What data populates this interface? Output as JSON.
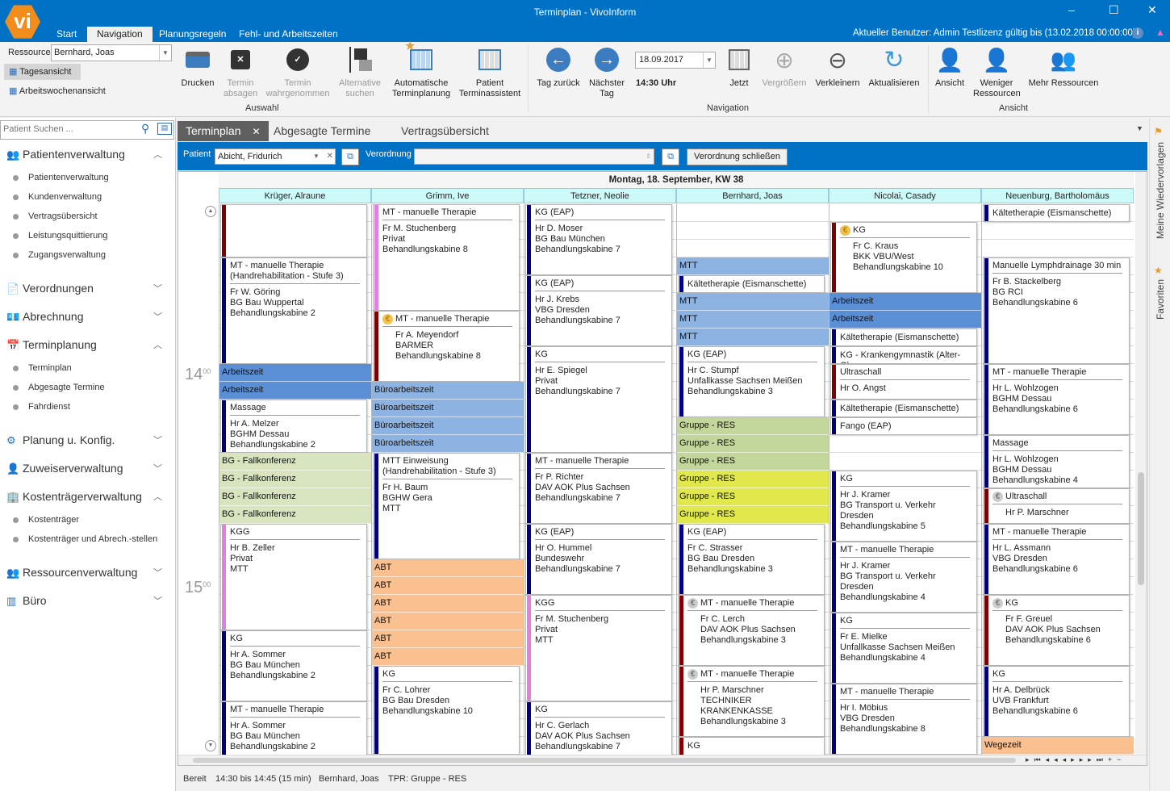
{
  "window": {
    "title": "Terminplan - VivoInform",
    "logo": "vi",
    "user_info": "Aktueller Benutzer: Admin Testlizenz gültig bis (13.02.2018 00:00:00)",
    "minimize": "–",
    "maximize": "☐",
    "close": "✕"
  },
  "ribbon_tabs": [
    "Start",
    "Navigation",
    "Planungsregeln",
    "Fehl- und Arbeitszeiten"
  ],
  "ribbon": {
    "ressource_label": "Ressource",
    "ressource_value": "Bernhard, Joas",
    "views": [
      "Tagesansicht",
      "Arbeitswochenansicht"
    ],
    "auswahl": {
      "label": "Auswahl",
      "buttons": [
        "Drucken",
        "Termin absagen",
        "Termin wahrgenommen",
        "Alternative suchen",
        "Automatische Terminplanung",
        "Patient Terminassistent"
      ]
    },
    "navigation": {
      "label": "Navigation",
      "back": "Tag zurück",
      "next": "Nächster Tag",
      "date": "18.09.2017",
      "time": "14:30 Uhr",
      "buttons": [
        "Jetzt",
        "Vergrößern",
        "Verkleinern",
        "Aktualisieren"
      ]
    },
    "ansicht": {
      "label": "Ansicht",
      "buttons": [
        "Ansicht",
        "Weniger Ressourcen",
        "Mehr Ressourcen"
      ]
    }
  },
  "sidebar": {
    "search_placeholder": "Patient Suchen ...",
    "sections": [
      {
        "label": "Patientenverwaltung",
        "expanded": true,
        "items": [
          "Patientenverwaltung",
          "Kundenverwaltung",
          "Vertragsübersicht",
          "Leistungsquittierung",
          "Zugangsverwaltung"
        ]
      },
      {
        "label": "Verordnungen",
        "expanded": false,
        "items": []
      },
      {
        "label": "Abrechnung",
        "expanded": false,
        "items": []
      },
      {
        "label": "Terminplanung",
        "expanded": true,
        "items": [
          "Terminplan",
          "Abgesagte Termine",
          "Fahrdienst"
        ]
      },
      {
        "label": "Planung u. Konfig.",
        "expanded": false,
        "items": []
      },
      {
        "label": "Zuweiserverwaltung",
        "expanded": false,
        "items": []
      },
      {
        "label": "Kostenträgerverwaltung",
        "expanded": true,
        "items": [
          "Kostenträger",
          "Kostenträger und Abrech.-stellen"
        ]
      },
      {
        "label": "Ressourcenverwaltung",
        "expanded": false,
        "items": []
      },
      {
        "label": "Büro",
        "expanded": false,
        "items": []
      }
    ]
  },
  "rightbar": {
    "wiedervorlagen": "Meine Wiedervorlagen",
    "favoriten": "Favoriten"
  },
  "doc_tabs": [
    "Terminplan",
    "Abgesagte Termine",
    "Vertragsübersicht"
  ],
  "patient_bar": {
    "patient_label": "Patient",
    "patient_value": "Abicht, Fridurich",
    "verordnung_label": "Verordnung",
    "verordnung_value": "",
    "close_button": "Verordnung schließen"
  },
  "calendar": {
    "date_header": "Montag, 18. September, KW 38",
    "visible_start": "13:15",
    "visible_end": "15:50",
    "time_labels": [
      {
        "h": "14",
        "m": "00"
      },
      {
        "h": "15",
        "m": "00"
      }
    ],
    "colors": {
      "navy": "#000080",
      "red": "#7f0000",
      "pink": "#e080e0",
      "arbeitszeit": "#5a8fd6",
      "buero": "#8db3e2",
      "fallkonferenz": "#d7e4bd",
      "gruppe": "#c3d69b",
      "gruppe_hl": "#e0e84c",
      "abt": "#fac08f"
    },
    "columns": [
      {
        "name": "Krüger, Alraune",
        "entries": [
          {
            "s": "13:15",
            "e": "13:30",
            "bar": "red",
            "title": "",
            "lines": []
          },
          {
            "s": "13:30",
            "e": "14:00",
            "bar": "navy",
            "title": "MT - manuelle Therapie (Handrehabilitation - Stufe 3)",
            "lines": [
              "Fr W. Göring",
              "BG Bau Wuppertal",
              "Behandlungskabine 2"
            ]
          },
          {
            "s": "14:00",
            "e": "14:05",
            "block": "arbeitszeit",
            "title": "Arbeitszeit"
          },
          {
            "s": "14:05",
            "e": "14:10",
            "block": "arbeitszeit",
            "title": "Arbeitszeit"
          },
          {
            "s": "14:10",
            "e": "14:25",
            "bar": "navy",
            "title": "Massage",
            "lines": [
              "Hr A. Melzer",
              "BGHM Dessau",
              "Behandlungskabine 2"
            ]
          },
          {
            "s": "14:25",
            "e": "14:30",
            "block": "fallkonferenz",
            "title": "BG - Fallkonferenz"
          },
          {
            "s": "14:30",
            "e": "14:35",
            "block": "fallkonferenz",
            "title": "BG - Fallkonferenz"
          },
          {
            "s": "14:35",
            "e": "14:40",
            "block": "fallkonferenz",
            "title": "BG - Fallkonferenz"
          },
          {
            "s": "14:40",
            "e": "14:45",
            "block": "fallkonferenz",
            "title": "BG - Fallkonferenz"
          },
          {
            "s": "14:45",
            "e": "15:15",
            "bar": "pink",
            "title": "KGG",
            "lines": [
              "Hr B. Zeller",
              "Privat",
              "MTT"
            ]
          },
          {
            "s": "15:15",
            "e": "15:35",
            "bar": "navy",
            "title": "KG",
            "lines": [
              "Hr A. Sommer",
              "BG Bau München",
              "Behandlungskabine 2"
            ]
          },
          {
            "s": "15:35",
            "e": "15:55",
            "bar": "navy",
            "title": "MT - manuelle Therapie",
            "lines": [
              "Hr A. Sommer",
              "BG Bau München",
              "Behandlungskabine 2"
            ]
          }
        ]
      },
      {
        "name": "Grimm, Ive",
        "entries": [
          {
            "s": "13:15",
            "e": "13:45",
            "bar": "pink",
            "title": "MT - manuelle Therapie",
            "lines": [
              "Fr M. Stuchenberg",
              "Privat",
              "Behandlungskabine 8"
            ]
          },
          {
            "s": "13:45",
            "e": "14:05",
            "bar": "red",
            "icon": "euro",
            "title": "MT - manuelle Therapie",
            "lines": [
              "Fr A. Meyendorf",
              "BARMER",
              "Behandlungskabine 8"
            ]
          },
          {
            "s": "14:05",
            "e": "14:10",
            "block": "buero",
            "title": "Büroarbeitszeit"
          },
          {
            "s": "14:10",
            "e": "14:15",
            "block": "buero",
            "title": "Büroarbeitszeit"
          },
          {
            "s": "14:15",
            "e": "14:20",
            "block": "buero",
            "title": "Büroarbeitszeit"
          },
          {
            "s": "14:20",
            "e": "14:25",
            "block": "buero",
            "title": "Büroarbeitszeit"
          },
          {
            "s": "14:25",
            "e": "14:55",
            "bar": "navy",
            "title": "MTT Einweisung (Handrehabilitation - Stufe 3)",
            "lines": [
              "Fr H. Baum",
              "BGHW Gera",
              "MTT"
            ]
          },
          {
            "s": "14:55",
            "e": "15:00",
            "block": "abt",
            "title": "ABT"
          },
          {
            "s": "15:00",
            "e": "15:05",
            "block": "abt",
            "title": "ABT"
          },
          {
            "s": "15:05",
            "e": "15:10",
            "block": "abt",
            "title": "ABT"
          },
          {
            "s": "15:10",
            "e": "15:15",
            "block": "abt",
            "title": "ABT"
          },
          {
            "s": "15:15",
            "e": "15:20",
            "block": "abt",
            "title": "ABT"
          },
          {
            "s": "15:20",
            "e": "15:25",
            "block": "abt",
            "title": "ABT"
          },
          {
            "s": "15:25",
            "e": "15:50",
            "bar": "navy",
            "title": "KG",
            "lines": [
              "Fr C. Lohrer",
              "BG Bau Dresden",
              "Behandlungskabine 10"
            ]
          }
        ]
      },
      {
        "name": "Tetzner, Neolie",
        "entries": [
          {
            "s": "13:15",
            "e": "13:35",
            "bar": "navy",
            "title": "KG (EAP)",
            "lines": [
              "Hr D. Moser",
              "BG Bau München",
              "Behandlungskabine 7"
            ]
          },
          {
            "s": "13:35",
            "e": "13:55",
            "bar": "navy",
            "title": "KG (EAP)",
            "lines": [
              "Hr J. Krebs",
              "VBG Dresden",
              "Behandlungskabine 7"
            ]
          },
          {
            "s": "13:55",
            "e": "14:25",
            "bar": "navy",
            "title": "KG",
            "lines": [
              "Hr E. Spiegel",
              "Privat",
              "Behandlungskabine 7"
            ]
          },
          {
            "s": "14:25",
            "e": "14:45",
            "bar": "navy",
            "title": "MT - manuelle Therapie",
            "lines": [
              "Fr P. Richter",
              "DAV AOK Plus Sachsen",
              "Behandlungskabine 7"
            ]
          },
          {
            "s": "14:45",
            "e": "15:05",
            "bar": "navy",
            "title": "KG (EAP)",
            "lines": [
              "Hr O. Hummel",
              "Bundeswehr",
              "Behandlungskabine 7"
            ]
          },
          {
            "s": "15:05",
            "e": "15:35",
            "bar": "pink",
            "title": "KGG",
            "lines": [
              "Fr M. Stuchenberg",
              "Privat",
              "MTT"
            ]
          },
          {
            "s": "15:35",
            "e": "15:55",
            "bar": "navy",
            "title": "KG",
            "lines": [
              "Hr C. Gerlach",
              "DAV AOK Plus Sachsen",
              "Behandlungskabine 7"
            ]
          }
        ]
      },
      {
        "name": "Bernhard, Joas",
        "entries": [
          {
            "s": "13:30",
            "e": "13:35",
            "block": "buero",
            "title": "MTT"
          },
          {
            "s": "13:35",
            "e": "13:40",
            "bar": "navy",
            "title": "Kältetherapie (Eismanschette)",
            "lines": []
          },
          {
            "s": "13:40",
            "e": "13:45",
            "block": "buero",
            "title": "MTT"
          },
          {
            "s": "13:45",
            "e": "13:50",
            "block": "buero",
            "title": "MTT"
          },
          {
            "s": "13:50",
            "e": "13:55",
            "block": "buero",
            "title": "MTT"
          },
          {
            "s": "13:55",
            "e": "14:15",
            "bar": "navy",
            "title": "KG (EAP)",
            "lines": [
              "Hr C. Stumpf",
              "Unfallkasse Sachsen Meißen",
              "Behandlungskabine 3"
            ]
          },
          {
            "s": "14:15",
            "e": "14:20",
            "block": "gruppe",
            "title": "Gruppe - RES"
          },
          {
            "s": "14:20",
            "e": "14:25",
            "block": "gruppe",
            "title": "Gruppe - RES"
          },
          {
            "s": "14:25",
            "e": "14:30",
            "block": "gruppe",
            "title": "Gruppe - RES"
          },
          {
            "s": "14:30",
            "e": "14:35",
            "block": "gruppe_hl",
            "title": "Gruppe - RES"
          },
          {
            "s": "14:35",
            "e": "14:40",
            "block": "gruppe_hl",
            "title": "Gruppe - RES"
          },
          {
            "s": "14:40",
            "e": "14:45",
            "block": "gruppe_hl",
            "title": "Gruppe - RES"
          },
          {
            "s": "14:45",
            "e": "15:05",
            "bar": "navy",
            "title": "KG (EAP)",
            "lines": [
              "Fr C. Strasser",
              "BG Bau Dresden",
              "Behandlungskabine 3"
            ]
          },
          {
            "s": "15:05",
            "e": "15:25",
            "bar": "red",
            "icon": "coin",
            "title": "MT - manuelle Therapie",
            "lines": [
              "Fr C. Lerch",
              "DAV AOK Plus Sachsen",
              "Behandlungskabine 3"
            ]
          },
          {
            "s": "15:25",
            "e": "15:45",
            "bar": "red",
            "icon": "coin",
            "title": "MT - manuelle Therapie",
            "lines": [
              "Hr P. Marschner",
              "TECHNIKER KRANKENKASSE",
              "Behandlungskabine 3"
            ]
          },
          {
            "s": "15:45",
            "e": "15:55",
            "bar": "red",
            "title": "KG",
            "lines": []
          }
        ]
      },
      {
        "name": "Nicolai, Casady",
        "entries": [
          {
            "s": "13:20",
            "e": "13:40",
            "bar": "red",
            "icon": "euro",
            "title": "KG",
            "lines": [
              "Fr C. Kraus",
              "BKK VBU/West",
              "Behandlungskabine 10"
            ]
          },
          {
            "s": "13:40",
            "e": "13:45",
            "block": "arbeitszeit",
            "title": "Arbeitszeit"
          },
          {
            "s": "13:45",
            "e": "13:50",
            "block": "arbeitszeit",
            "title": "Arbeitszeit"
          },
          {
            "s": "13:50",
            "e": "13:55",
            "bar": "navy",
            "title": "Kältetherapie (Eismanschette)",
            "lines": []
          },
          {
            "s": "13:55",
            "e": "14:00",
            "bar": "navy",
            "title": "KG - Krankengymnastik (Alter-G)",
            "lines": []
          },
          {
            "s": "14:00",
            "e": "14:10",
            "bar": "red",
            "title": "Ultraschall",
            "lines": [
              "Hr O. Angst"
            ]
          },
          {
            "s": "14:10",
            "e": "14:15",
            "bar": "navy",
            "title": "Kältetherapie (Eismanschette)",
            "lines": []
          },
          {
            "s": "14:15",
            "e": "14:20",
            "bar": "navy",
            "title": "Fango (EAP)",
            "lines": []
          },
          {
            "s": "14:30",
            "e": "14:50",
            "bar": "navy",
            "title": "KG",
            "lines": [
              "Hr J. Kramer",
              "BG Transport u. Verkehr Dresden",
              "Behandlungskabine 5"
            ]
          },
          {
            "s": "14:50",
            "e": "15:10",
            "bar": "navy",
            "title": "MT - manuelle Therapie",
            "lines": [
              "Hr J. Kramer",
              "BG Transport u. Verkehr Dresden",
              "Behandlungskabine 4"
            ]
          },
          {
            "s": "15:10",
            "e": "15:30",
            "bar": "navy",
            "title": "KG",
            "lines": [
              "Fr E. Mielke",
              "Unfallkasse Sachsen Meißen",
              "Behandlungskabine 4"
            ]
          },
          {
            "s": "15:30",
            "e": "15:50",
            "bar": "navy",
            "title": "MT - manuelle Therapie",
            "lines": [
              "Hr I. Möbius",
              "VBG Dresden",
              "Behandlungskabine 8"
            ]
          }
        ]
      },
      {
        "name": "Neuenburg, Bartholomäus",
        "entries": [
          {
            "s": "13:15",
            "e": "13:20",
            "bar": "navy",
            "title": "Kältetherapie (Eismanschette)",
            "lines": []
          },
          {
            "s": "13:30",
            "e": "14:00",
            "bar": "navy",
            "title": "Manuelle Lymphdrainage 30 min",
            "lines": [
              "Fr B. Stackelberg",
              "BG RCI",
              "Behandlungskabine 6"
            ]
          },
          {
            "s": "14:00",
            "e": "14:20",
            "bar": "navy",
            "title": "MT - manuelle Therapie",
            "lines": [
              "Hr L. Wohlzogen",
              "BGHM Dessau",
              "Behandlungskabine 6"
            ]
          },
          {
            "s": "14:20",
            "e": "14:35",
            "bar": "navy",
            "title": "Massage",
            "lines": [
              "Hr L. Wohlzogen",
              "BGHM Dessau",
              "Behandlungskabine 4"
            ]
          },
          {
            "s": "14:35",
            "e": "14:45",
            "bar": "red",
            "icon": "coin",
            "title": "Ultraschall",
            "lines": [
              "Hr P. Marschner"
            ]
          },
          {
            "s": "14:45",
            "e": "15:05",
            "bar": "navy",
            "title": "MT - manuelle Therapie",
            "lines": [
              "Hr L. Assmann",
              "VBG Dresden",
              "Behandlungskabine 6"
            ]
          },
          {
            "s": "15:05",
            "e": "15:25",
            "bar": "red",
            "icon": "coin",
            "title": "KG",
            "lines": [
              "Fr F. Greuel",
              "DAV AOK Plus Sachsen",
              "Behandlungskabine 6"
            ]
          },
          {
            "s": "15:25",
            "e": "15:45",
            "bar": "navy",
            "title": "KG",
            "lines": [
              "Hr A. Delbrück",
              "UVB Frankfurt",
              "Behandlungskabine 6"
            ]
          },
          {
            "s": "15:45",
            "e": "15:50",
            "block": "abt",
            "title": "Wegezeit"
          }
        ]
      }
    ]
  },
  "status": {
    "state": "Bereit",
    "range": "14:30 bis 14:45 (15 min)",
    "resource": "Bernhard, Joas",
    "tpr": "TPR: Gruppe - RES"
  }
}
